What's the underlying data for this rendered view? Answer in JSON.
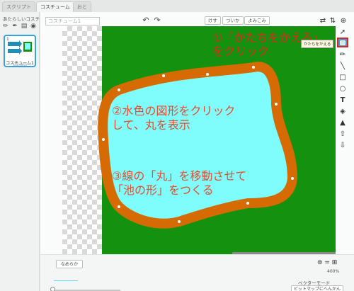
{
  "tabs": [
    {
      "label": "スクリプト"
    },
    {
      "label": "コスチューム"
    },
    {
      "label": "おと"
    }
  ],
  "left_panel": {
    "new_costume_label": "あたらしいコスチューム:",
    "tool_icons": [
      "paint-brush-icon",
      "pencil-icon",
      "import-folder-icon",
      "camera-icon"
    ],
    "costume": {
      "number": "1",
      "name": "コスチューム1",
      "size": "458x360"
    }
  },
  "editor": {
    "costume_name_value": "コスチューム1",
    "buttons": {
      "clear": "けす",
      "add": "ついか",
      "import": "よみこみ"
    },
    "tooltip": "かたちをかえる",
    "smooth_button": "なめらか",
    "zoom_controls": "⊜ = ⊞",
    "zoom_level": "400%",
    "mode_label": "ベクターモード",
    "convert_button": "ビットマップにへんかん"
  },
  "annotations": {
    "step1_line1": "①「かたちをかえる」",
    "step1_line2": "をクリック",
    "step2_line1": "②水色の図形をクリック",
    "step2_line2": "して、丸を表示",
    "step3_line1": "③線の「丸」を移動させて",
    "step3_line2": "「池の形」をつくる"
  },
  "colors": {
    "background_green": "#14920f",
    "pond_fill": "#7ffcfc",
    "pond_outline": "#d66b04",
    "selected_tool": "#3aa1d8",
    "annotation_red": "#e8231e"
  },
  "right_tools": [
    "select-icon",
    "reshape-icon",
    "pencil-icon",
    "line-icon",
    "rectangle-icon",
    "ellipse-icon",
    "text-icon",
    "fill-icon",
    "stamp-icon",
    "forward-layer-icon",
    "back-layer-icon"
  ]
}
